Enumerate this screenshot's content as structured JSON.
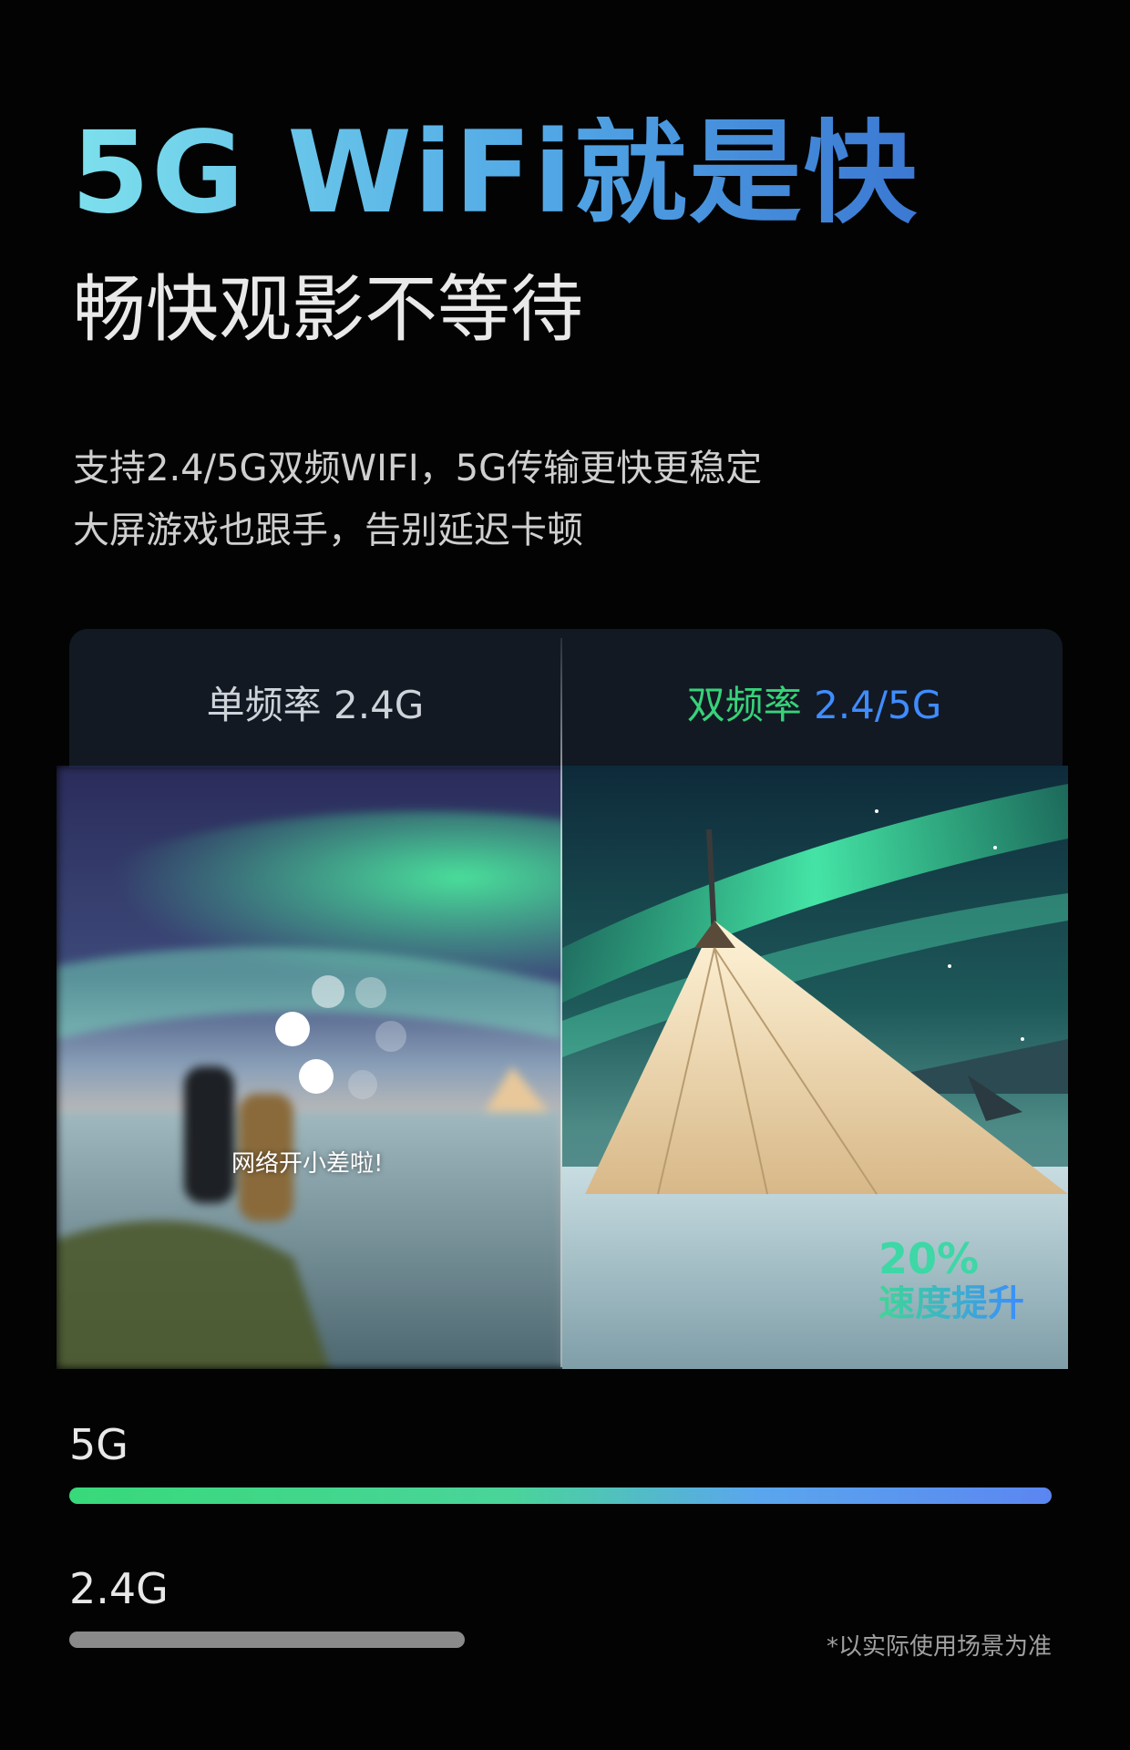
{
  "headline": "5G WiFi就是快",
  "subheadline": "畅快观影不等待",
  "description": {
    "line1": "支持2.4/5G双频WIFI，5G传输更快更稳定",
    "line2": "大屏游戏也跟手，告别延迟卡顿"
  },
  "comparison": {
    "single_label": "单频率 2.4G",
    "dual_label_part1": "双频率 ",
    "dual_label_part2": "2.4/5G",
    "lag_message": "网络开小差啦!",
    "boost_value": "20%",
    "boost_label": "速度提升"
  },
  "speed_bars": {
    "band_5g": {
      "label": "5G",
      "relative_level": 1.0
    },
    "band_24g": {
      "label": "2.4G",
      "relative_level": 0.4
    }
  },
  "footnote": "*以实际使用场景为准",
  "colors": {
    "background": "#030303",
    "headline_gradient": [
      "#7de0ec",
      "#3b78d2"
    ],
    "dual_green": "#37d279",
    "dual_blue": "#3f8cff",
    "bar_5g_gradient": [
      "#38d97a",
      "#5b86f0"
    ],
    "bar_24g": "#8a8a8a"
  }
}
